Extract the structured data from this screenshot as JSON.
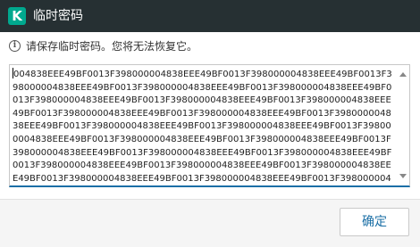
{
  "window": {
    "title": "临时密码",
    "logo_letter": "K"
  },
  "info": {
    "icon": "info-icon",
    "text": "请保存临时密码。您将无法恢复它。"
  },
  "password_field": {
    "value": "004838EEE49BF0013F398000004838EEE49BF0013F398000004838EEE49BF0013F398000004838EEE49BF0013F398000004838EEE49BF0013F398000004838EEE49BF0013F398000004838EEE49BF0013F398000004838EEE49BF0013F398000004838EEE49BF0013F398000004838EEE49BF0013F398000004838EEE49BF0013F398000004838EEE49BF0013F398000004838EEE49BF0013F398000004838EEE49BF0013F398000004838EEE49BF0013F398000004838EEE49BF0013F398000004838EEE49BF0013F398000004838EEE49BF0013F398000004838EEE49BF0013F398000004838EEE49BF0013F398000004838EEE49BF0013F398000004838EEE49BF0013F398000004838EEE49BF0013F398000004838EEE49BF0013F398000004838EEE49BF0013F398000004838EEE49BF0013F398000004838EEE49BF0013F398000"
  },
  "footer": {
    "ok_label": "确定"
  },
  "colors": {
    "titlebar": "#263033",
    "brand": "#00a88e",
    "accent": "#1b6fa6"
  }
}
